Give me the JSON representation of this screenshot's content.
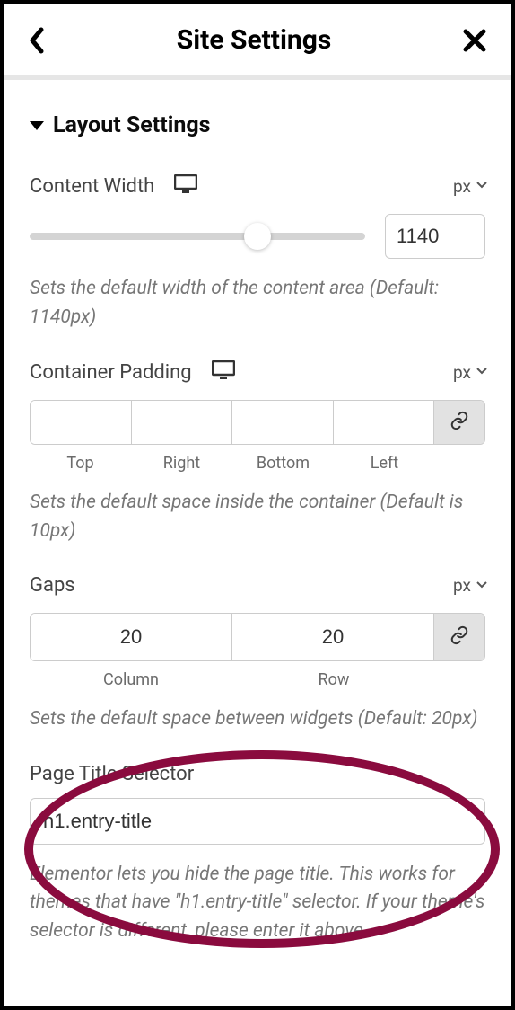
{
  "header": {
    "title": "Site Settings"
  },
  "section": {
    "title": "Layout Settings"
  },
  "contentWidth": {
    "label": "Content Width",
    "unit": "px",
    "value": "1140",
    "help": "Sets the default width of the content area (Default: 1140px)"
  },
  "containerPadding": {
    "label": "Container Padding",
    "unit": "px",
    "sides": {
      "top": {
        "label": "Top",
        "value": ""
      },
      "right": {
        "label": "Right",
        "value": ""
      },
      "bottom": {
        "label": "Bottom",
        "value": ""
      },
      "left": {
        "label": "Left",
        "value": ""
      }
    },
    "help": "Sets the default space inside the container (Default is 10px)"
  },
  "gaps": {
    "label": "Gaps",
    "unit": "px",
    "column": {
      "label": "Column",
      "value": "20"
    },
    "row": {
      "label": "Row",
      "value": "20"
    },
    "help": "Sets the default space between widgets (Default: 20px)"
  },
  "pageTitleSelector": {
    "label": "Page Title Selector",
    "value": "h1.entry-title",
    "help": "Elementor lets you hide the page title. This works for themes that have \"h1.entry-title\" selector. If your theme's selector is different, please enter it above."
  }
}
